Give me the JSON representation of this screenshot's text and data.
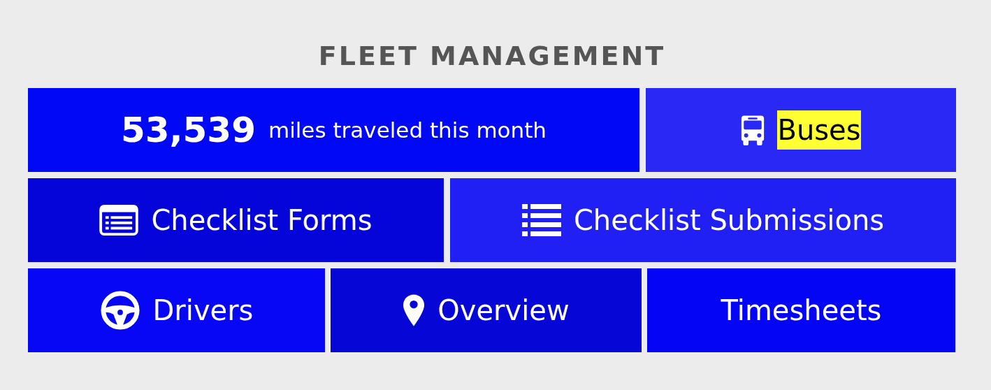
{
  "title": "FLEET MANAGEMENT",
  "rows": [
    [
      {
        "kind": "stat",
        "value": "53,539",
        "label": "miles traveled this month",
        "color": "#0008f5"
      },
      {
        "kind": "bus",
        "label": "Buses",
        "highlighted": true,
        "color": "#2a28f5"
      }
    ],
    [
      {
        "kind": "form",
        "label": "Checklist Forms",
        "highlighted": false,
        "color": "#0505d9"
      },
      {
        "kind": "list",
        "label": "Checklist Submissions",
        "highlighted": false,
        "color": "#2020f5"
      }
    ],
    [
      {
        "kind": "wheel",
        "label": "Drivers",
        "highlighted": false,
        "color": "#0707f6"
      },
      {
        "kind": "pin",
        "label": "Overview",
        "highlighted": false,
        "color": "#0606d6"
      },
      {
        "kind": "plain",
        "label": "Timesheets",
        "highlighted": false,
        "color": "#0505f5"
      }
    ]
  ]
}
